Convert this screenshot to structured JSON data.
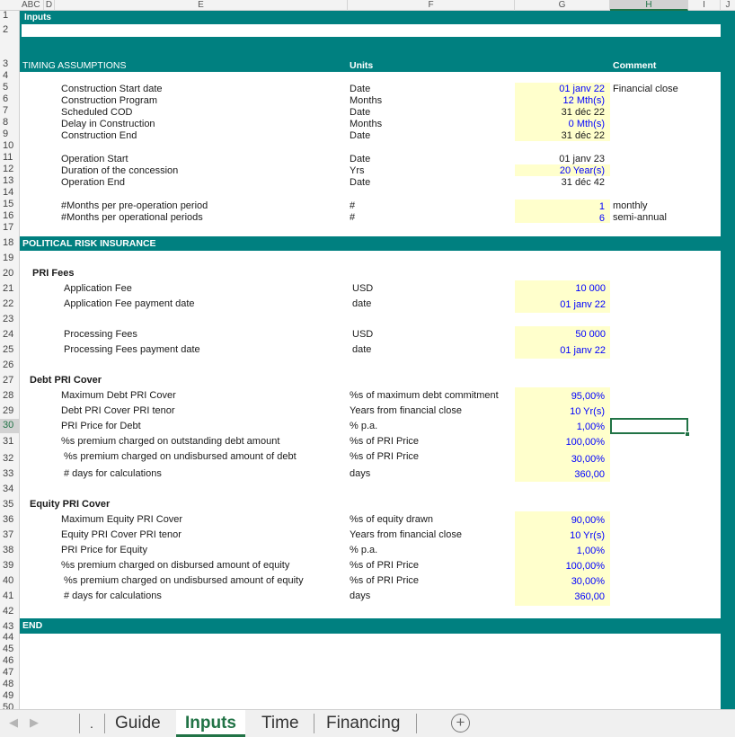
{
  "columns": [
    "ABC",
    "D",
    "E",
    "F",
    "G",
    "H",
    "I",
    "J"
  ],
  "rows": [
    "1",
    "2",
    "3",
    "4",
    "5",
    "6",
    "7",
    "8",
    "9",
    "10",
    "11",
    "12",
    "13",
    "14",
    "15",
    "16",
    "17",
    "18",
    "19",
    "20",
    "21",
    "22",
    "23",
    "24",
    "25",
    "26",
    "27",
    "28",
    "29",
    "30",
    "31",
    "32",
    "33",
    "34",
    "35",
    "36",
    "37",
    "38",
    "39",
    "40",
    "41",
    "42",
    "43",
    "44",
    "45",
    "46",
    "47",
    "48",
    "49",
    "50"
  ],
  "header": {
    "inputs": "Inputs"
  },
  "timing": {
    "section": "TIMING ASSUMPTIONS",
    "units_header": "Units",
    "comment_header": "Comment",
    "rows": [
      {
        "label": "Construction Start date",
        "unit": "Date",
        "value": "01 janv 22",
        "comment": "Financial close"
      },
      {
        "label": "Construction Program",
        "unit": "Months",
        "value": "12 Mth(s)",
        "comment": ""
      },
      {
        "label": "Scheduled COD",
        "unit": "Date",
        "value": "31 déc 22",
        "comment": ""
      },
      {
        "label": "Delay in Construction",
        "unit": "Months",
        "value": "0 Mth(s)",
        "comment": ""
      },
      {
        "label": "Construction End",
        "unit": "Date",
        "value": "31 déc 22",
        "comment": ""
      },
      {
        "label": "Operation Start",
        "unit": "Date",
        "value": "01 janv 23",
        "comment": ""
      },
      {
        "label": "Duration of the concession",
        "unit": "Yrs",
        "value": "20 Year(s)",
        "comment": ""
      },
      {
        "label": "Operation End",
        "unit": "Date",
        "value": "31 déc 42",
        "comment": ""
      },
      {
        "label": "#Months per pre-operation period",
        "unit": "#",
        "value": "1",
        "comment": "monthly"
      },
      {
        "label": "#Months per operational periods",
        "unit": "#",
        "value": "6",
        "comment": "semi-annual"
      }
    ]
  },
  "pri": {
    "section": "POLITICAL RISK INSURANCE",
    "fees_title": "PRI Fees",
    "fees": [
      {
        "label": "Application Fee",
        "unit": "USD",
        "value": "10 000"
      },
      {
        "label": "Application Fee payment date",
        "unit": "date",
        "value": "01 janv 22"
      },
      {
        "label": "Processing Fees",
        "unit": "USD",
        "value": "50 000"
      },
      {
        "label": "Processing Fees payment date",
        "unit": "date",
        "value": "01 janv 22"
      }
    ],
    "debt_title": "Debt PRI Cover",
    "debt": [
      {
        "label": "Maximum Debt PRI Cover",
        "unit": "%s of maximum debt commitment",
        "value": "95,00%"
      },
      {
        "label": "Debt PRI Cover PRI tenor",
        "unit": "Years from financial close",
        "value": "10 Yr(s)"
      },
      {
        "label": "PRI Price for Debt",
        "unit": "% p.a.",
        "value": "1,00%"
      },
      {
        "label": "%s premium charged on outstanding debt amount",
        "unit": "%s of PRI Price",
        "value": "100,00%"
      },
      {
        "label": "%s premium charged on undisbursed amount of debt",
        "unit": "%s of PRI Price",
        "value": "30,00%"
      },
      {
        "label": "# days for calculations",
        "unit": "days",
        "value": "360,00"
      }
    ],
    "equity_title": "Equity PRI Cover",
    "equity": [
      {
        "label": "Maximum Equity PRI Cover",
        "unit": "%s of equity drawn",
        "value": "90,00%"
      },
      {
        "label": "Equity PRI Cover PRI tenor",
        "unit": "Years from financial close",
        "value": "10 Yr(s)"
      },
      {
        "label": "PRI Price for Equity",
        "unit": "% p.a.",
        "value": "1,00%"
      },
      {
        "label": "%s premium charged on disbursed amount of equity",
        "unit": "%s of PRI Price",
        "value": "100,00%"
      },
      {
        "label": "%s premium charged on undisbursed amount of equity",
        "unit": "%s of PRI Price",
        "value": "30,00%"
      },
      {
        "label": "# days for calculations",
        "unit": "days",
        "value": "360,00"
      }
    ]
  },
  "end_label": "END",
  "tabs": {
    "dot": ".",
    "guide": "Guide",
    "inputs": "Inputs",
    "time": "Time",
    "financing": "Financing",
    "add": "+"
  },
  "colors": {
    "band": "#008080",
    "input_fill": "#ffffcc",
    "input_text": "#0000ff",
    "selection": "#217346"
  }
}
